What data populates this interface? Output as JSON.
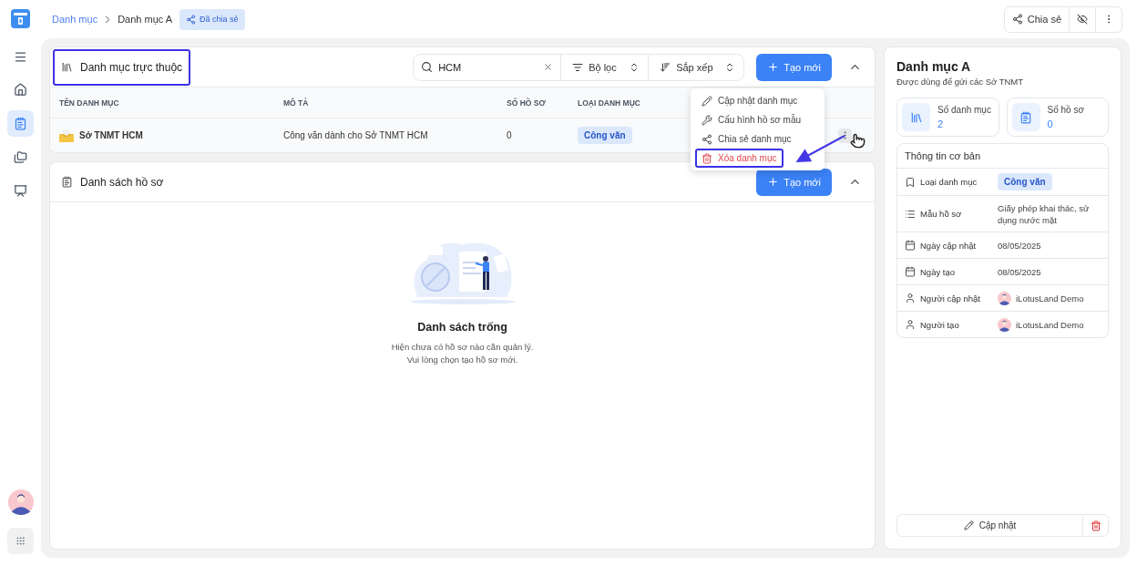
{
  "breadcrumb": [
    {
      "label": "Danh mục",
      "link": true
    },
    {
      "label": "Danh mục A",
      "link": false
    }
  ],
  "shared_badge": "Đã chia sẻ",
  "top_actions": {
    "share": "Chia sẻ"
  },
  "sidebar": {
    "items": [
      {
        "kind": "home",
        "selected": false
      },
      {
        "kind": "records",
        "selected": true
      },
      {
        "kind": "folders",
        "selected": false
      },
      {
        "kind": "board",
        "selected": false
      }
    ]
  },
  "subcategories": {
    "title": "Danh mục trực thuộc",
    "highlighted": true,
    "search": {
      "value": "HCM"
    },
    "filter": "Bộ lọc",
    "sort": "Sắp xếp",
    "create": "Tạo mới",
    "expanded": true,
    "columns": [
      "TÊN DANH MỤC",
      "MÔ TẢ",
      "SỐ HỒ SƠ",
      "LOẠI DANH MỤC"
    ],
    "rows": [
      {
        "name": "Sở TNMT HCM",
        "description": "Công văn dành cho Sở TNMT HCM",
        "count": "0",
        "type": "Công văn",
        "menu_open": true
      }
    ]
  },
  "row_menu": {
    "items": [
      {
        "label": "Cập nhật danh mục",
        "kind": "edit",
        "highlighted": false
      },
      {
        "label": "Cấu hình hồ sơ mẫu",
        "kind": "configure",
        "highlighted": false
      },
      {
        "label": "Chia sẻ danh mục",
        "kind": "share",
        "highlighted": false
      },
      {
        "label": "Xóa danh mục",
        "kind": "delete",
        "highlighted": true
      }
    ]
  },
  "records": {
    "title": "Danh sách hồ sơ",
    "create": "Tạo mới",
    "expanded": true,
    "empty": {
      "title": "Danh sách trống",
      "lines": [
        "Hiện chưa có hồ sơ nào cần quản lý.",
        "Vui lòng chọn tạo hồ sơ mới."
      ]
    }
  },
  "detail": {
    "title": "Danh mục A",
    "subtitle": "Được dùng để gửi các Sở TNMT",
    "stats": [
      {
        "kind": "categories",
        "label": "Số danh mục",
        "value": "2"
      },
      {
        "kind": "records",
        "label": "Số hồ sơ",
        "value": "0"
      }
    ],
    "info_title": "Thông tin cơ bản",
    "info": [
      {
        "kind": "tag",
        "label": "Loại danh mục",
        "value": "Công văn"
      },
      {
        "kind": "text",
        "label": "Mẫu hồ sơ",
        "value": "Giấy phép khai thác, sử dụng nước mặt"
      },
      {
        "kind": "date",
        "label": "Ngày cập nhật",
        "value": "08/05/2025"
      },
      {
        "kind": "date",
        "label": "Ngày tạo",
        "value": "08/05/2025"
      },
      {
        "kind": "user",
        "label": "Người cập nhật",
        "value": "iLotusLand Demo"
      },
      {
        "kind": "user",
        "label": "Người tạo",
        "value": "iLotusLand Demo"
      }
    ],
    "update": "Cập nhật"
  }
}
